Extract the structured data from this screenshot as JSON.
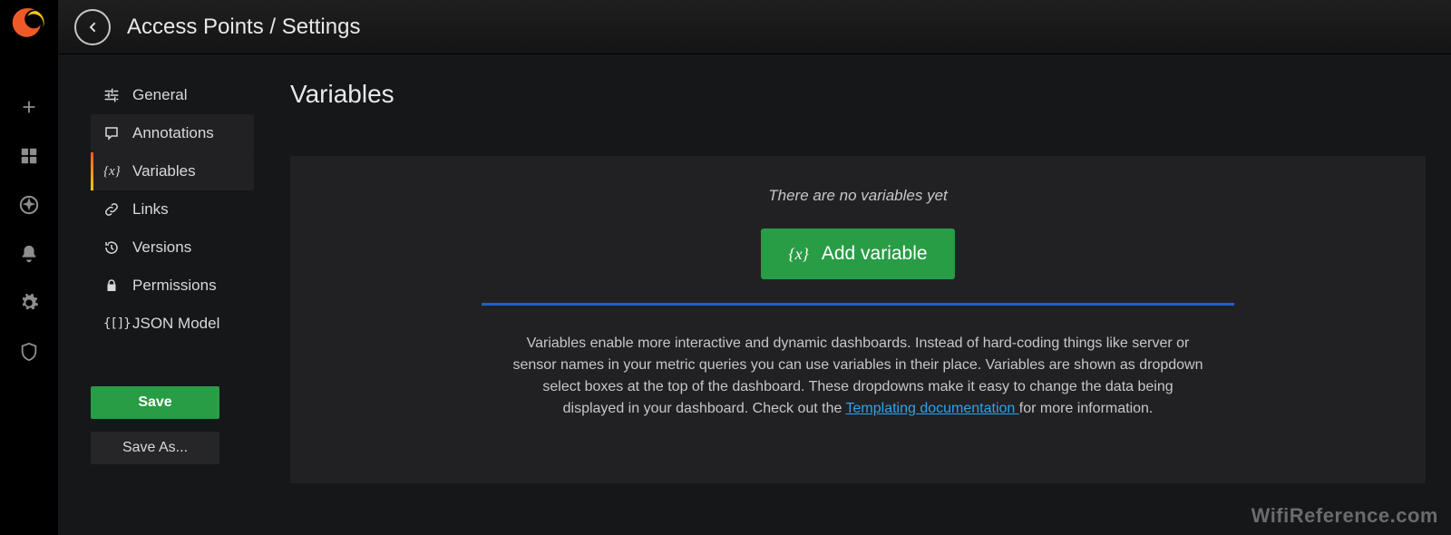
{
  "breadcrumb": "Access Points / Settings",
  "sidebar": {
    "items": [
      {
        "label": "General"
      },
      {
        "label": "Annotations"
      },
      {
        "label": "Variables"
      },
      {
        "label": "Links"
      },
      {
        "label": "Versions"
      },
      {
        "label": "Permissions"
      },
      {
        "label": "JSON Model"
      }
    ],
    "save_label": "Save",
    "save_as_label": "Save As..."
  },
  "main": {
    "title": "Variables",
    "empty_message": "There are no variables yet",
    "add_button_label": "Add variable",
    "info_text_before_link": "Variables enable more interactive and dynamic dashboards. Instead of hard-coding things like server or sensor names in your metric queries you can use variables in their place. Variables are shown as dropdown select boxes at the top of the dashboard. These dropdowns make it easy to change the data being displayed in your dashboard. Check out the ",
    "info_link_text": "Templating documentation ",
    "info_text_after_link": "for more information."
  },
  "watermark": "WifiReference.com"
}
